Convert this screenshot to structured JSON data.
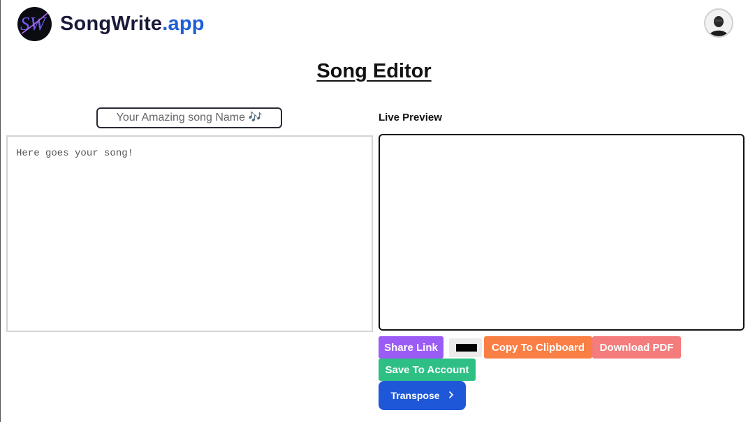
{
  "header": {
    "brand_name_part1": "SongWrite",
    "brand_name_part2": ".app",
    "logo_text": "SW"
  },
  "page_title": "Song Editor",
  "editor": {
    "song_name_placeholder": "Your Amazing song Name 🎶",
    "song_body_placeholder": "Here goes your song!"
  },
  "preview": {
    "label": "Live Preview"
  },
  "actions": {
    "share_label": "Share Link",
    "copy_label": "Copy To Clipboard",
    "pdf_label": "Download PDF",
    "save_label": "Save To Account",
    "transpose_label": "Transpose",
    "color_value": "#000000"
  },
  "colors": {
    "brand_blue": "#1f5fd6",
    "share": "#9b5cf6",
    "copy": "#f97f45",
    "pdf": "#f47c7c",
    "save": "#2dbf84",
    "transpose": "#1e58d8"
  }
}
